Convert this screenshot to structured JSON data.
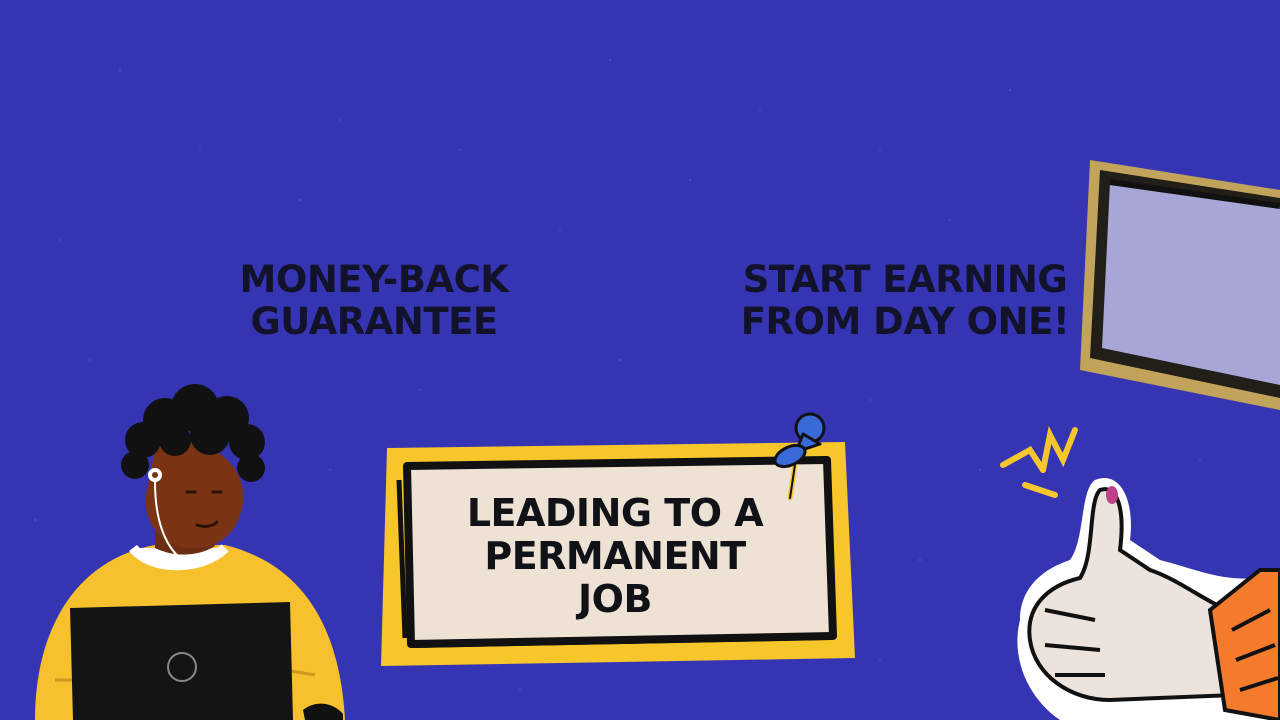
{
  "slide": {
    "background_color": "#3535b4",
    "text_color": "#12122a",
    "accent_yellow": "#f6c62b",
    "note_fill": "#ede2d4",
    "headline_left": [
      "MONEY-BACK",
      "GUARANTEE"
    ],
    "headline_right": [
      "START EARNING",
      "FROM DAY ONE!"
    ],
    "callout": [
      "LEADING TO A",
      "PERMANENT",
      "JOB"
    ]
  },
  "illustrations": {
    "person": "person-with-laptop-illustration",
    "pin": "pushpin-icon",
    "thumbs_up": "thumbs-up-hand-illustration",
    "tablet": "tablet-frame-illustration",
    "sparkle": "sparkle-lines-icon"
  }
}
